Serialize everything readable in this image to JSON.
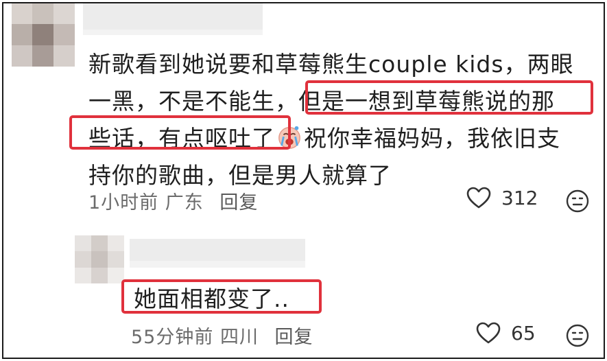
{
  "comment": {
    "text_line1": "新歌看到她说要和草莓熊生couple kids，两眼",
    "text_line2_plain": "一黑，不是不能生，",
    "text_line2_highlight": "但是一想到草莓熊说的那",
    "text_line3_highlight": "些话，有点呕吐了",
    "text_line3_rest": "祝你幸福妈妈，我依旧支",
    "text_line4": "持你的歌曲，但是男人就算了",
    "time": "1小时前",
    "location": "广东",
    "reply_label": "回复",
    "like_count": "312",
    "emoji_name": "crying-face-emoji"
  },
  "reply": {
    "text": "她面相都变了..",
    "time": "55分钟前",
    "location": "四川",
    "reply_label": "回复",
    "like_count": "65"
  },
  "colors": {
    "highlight_border": "#e0313c",
    "meta_text": "#6b6b6b"
  }
}
